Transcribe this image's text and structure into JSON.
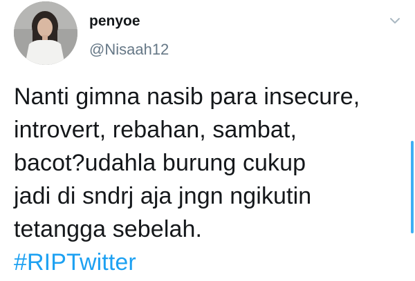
{
  "tweet": {
    "author": {
      "display_name": "penyoe",
      "handle": "@Nisaah12",
      "avatar_icon": "profile-photo-avatar"
    },
    "menu_icon": "chevron-down-icon",
    "text_lines": [
      "Nanti gimna nasib para insecure,",
      "introvert, rebahan, sambat,",
      "bacot?udahla burung cukup",
      "jadi di sndrj aja jngn ngikutin",
      "tetangga sebelah."
    ],
    "hashtag": "#RIPTwitter"
  },
  "colors": {
    "text": "#14171a",
    "secondary": "#657786",
    "accent": "#1da1f2"
  }
}
